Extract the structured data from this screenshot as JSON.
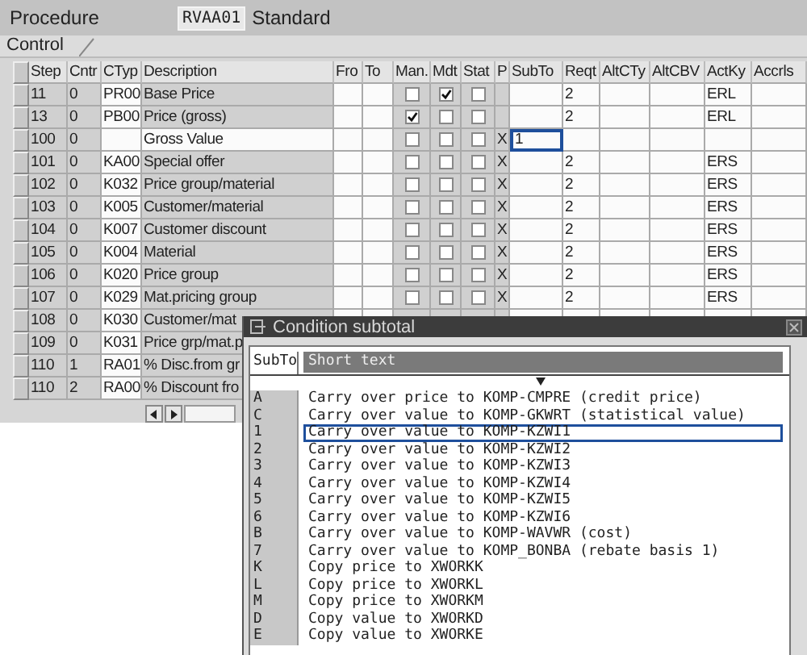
{
  "header": {
    "label": "Procedure",
    "value": "RVAA01",
    "description": "Standard"
  },
  "tab": {
    "label": "Control",
    "selected": true
  },
  "table": {
    "columns": [
      "Step",
      "Cntr",
      "CTyp",
      "Description",
      "Fro",
      "To",
      "Man.",
      "Mdt",
      "Stat",
      "P",
      "SubTo",
      "Reqt",
      "AltCTy",
      "AltCBV",
      "ActKy",
      "Accrls"
    ],
    "rows": [
      {
        "step": "11",
        "counter": "0",
        "condition_type": "PR00",
        "description": "Base Price",
        "editable_description": false,
        "manual": false,
        "mandatory": true,
        "statistical": false,
        "requirement": "2",
        "account_key": "ERL",
        "subtotal_focused": false
      },
      {
        "step": "13",
        "counter": "0",
        "condition_type": "PB00",
        "description": "Price (gross)",
        "editable_description": false,
        "manual": true,
        "mandatory": false,
        "statistical": false,
        "requirement": "2",
        "account_key": "ERL",
        "subtotal_focused": false
      },
      {
        "step": "100",
        "counter": "0",
        "description": "Gross Value",
        "editable_description": true,
        "manual": false,
        "mandatory": false,
        "statistical": false,
        "print": "X",
        "subtotal": "1",
        "subtotal_focused": true
      },
      {
        "step": "101",
        "counter": "0",
        "condition_type": "KA00",
        "description": "Special offer",
        "editable_description": false,
        "manual": false,
        "mandatory": false,
        "statistical": false,
        "print": "X",
        "requirement": "2",
        "account_key": "ERS",
        "subtotal_focused": false
      },
      {
        "step": "102",
        "counter": "0",
        "condition_type": "K032",
        "description": "Price group/material",
        "editable_description": false,
        "manual": false,
        "mandatory": false,
        "statistical": false,
        "print": "X",
        "requirement": "2",
        "account_key": "ERS",
        "subtotal_focused": false
      },
      {
        "step": "103",
        "counter": "0",
        "condition_type": "K005",
        "description": "Customer/material",
        "editable_description": false,
        "manual": false,
        "mandatory": false,
        "statistical": false,
        "print": "X",
        "requirement": "2",
        "account_key": "ERS",
        "subtotal_focused": false
      },
      {
        "step": "104",
        "counter": "0",
        "condition_type": "K007",
        "description": "Customer discount",
        "editable_description": false,
        "manual": false,
        "mandatory": false,
        "statistical": false,
        "print": "X",
        "requirement": "2",
        "account_key": "ERS",
        "subtotal_focused": false
      },
      {
        "step": "105",
        "counter": "0",
        "condition_type": "K004",
        "description": "Material",
        "editable_description": false,
        "manual": false,
        "mandatory": false,
        "statistical": false,
        "print": "X",
        "requirement": "2",
        "account_key": "ERS",
        "subtotal_focused": false
      },
      {
        "step": "106",
        "counter": "0",
        "condition_type": "K020",
        "description": "Price group",
        "editable_description": false,
        "manual": false,
        "mandatory": false,
        "statistical": false,
        "print": "X",
        "requirement": "2",
        "account_key": "ERS",
        "subtotal_focused": false
      },
      {
        "step": "107",
        "counter": "0",
        "condition_type": "K029",
        "description": "Mat.pricing group",
        "editable_description": false,
        "manual": false,
        "mandatory": false,
        "statistical": false,
        "print": "X",
        "requirement": "2",
        "account_key": "ERS",
        "subtotal_focused": false
      },
      {
        "step": "108",
        "counter": "0",
        "condition_type": "K030",
        "description": "Customer/mat",
        "editable_description": false
      },
      {
        "step": "109",
        "counter": "0",
        "condition_type": "K031",
        "description": "Price grp/mat.p",
        "editable_description": false
      },
      {
        "step": "110",
        "counter": "1",
        "condition_type": "RA01",
        "description": "% Disc.from gr",
        "editable_description": false
      },
      {
        "step": "110",
        "counter": "2",
        "condition_type": "RA00",
        "description": "% Discount fro",
        "editable_description": false
      }
    ]
  },
  "popup": {
    "title": "Condition subtotal",
    "columns": [
      "SubTo",
      "Short text"
    ],
    "items": [
      {
        "key": "A",
        "text": "Carry over price to KOMP-CMPRE (credit price)",
        "selected": false
      },
      {
        "key": "C",
        "text": "Carry over value to KOMP-GKWRT (statistical value)",
        "selected": false
      },
      {
        "key": "1",
        "text": "Carry over value to KOMP-KZWI1",
        "selected": true
      },
      {
        "key": "2",
        "text": "Carry over value to KOMP-KZWI2",
        "selected": false
      },
      {
        "key": "3",
        "text": "Carry over value to KOMP-KZWI3",
        "selected": false
      },
      {
        "key": "4",
        "text": "Carry over value to KOMP-KZWI4",
        "selected": false
      },
      {
        "key": "5",
        "text": "Carry over value to KOMP-KZWI5",
        "selected": false
      },
      {
        "key": "6",
        "text": "Carry over value to KOMP-KZWI6",
        "selected": false
      },
      {
        "key": "B",
        "text": "Carry over value to KOMP-WAVWR (cost)",
        "selected": false
      },
      {
        "key": "7",
        "text": "Carry over value to KOMP_BONBA (rebate basis 1)",
        "selected": false
      },
      {
        "key": "K",
        "text": "Copy price to XWORKK",
        "selected": false
      },
      {
        "key": "L",
        "text": "Copy price to XWORKL",
        "selected": false
      },
      {
        "key": "M",
        "text": "Copy price to XWORKM",
        "selected": false
      },
      {
        "key": "D",
        "text": "Copy value to XWORKD",
        "selected": false
      },
      {
        "key": "E",
        "text": "Copy value to XWORKE",
        "selected": false
      }
    ]
  }
}
